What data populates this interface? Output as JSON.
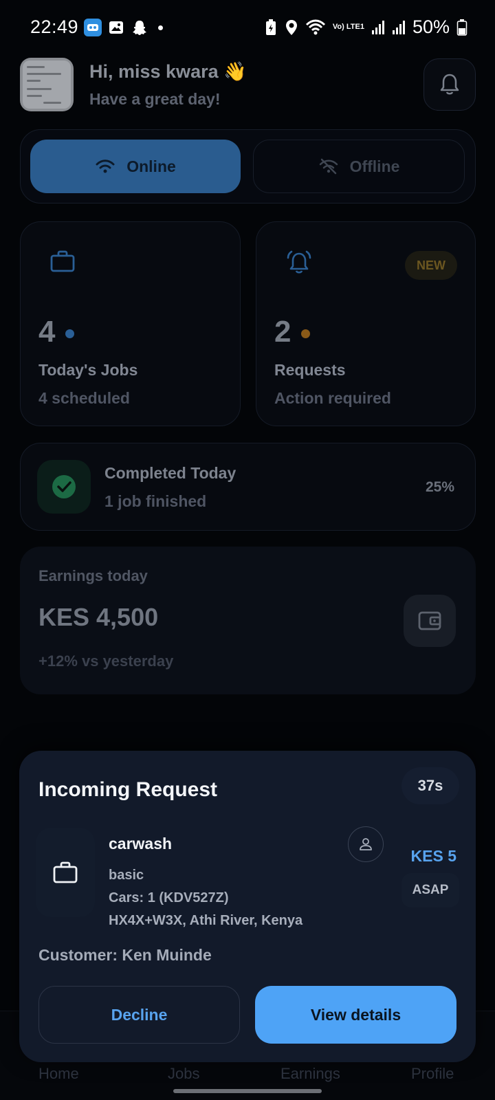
{
  "status_bar": {
    "time": "22:49",
    "battery": "50%",
    "network": "Vo) LTE1"
  },
  "header": {
    "greeting": "Hi, miss kwara 👋",
    "subtitle": "Have a great day!"
  },
  "availability": {
    "online_label": "Online",
    "offline_label": "Offline",
    "selected": "Online"
  },
  "stats": {
    "jobs": {
      "count": "4",
      "title": "Today's Jobs",
      "subtitle": "4 scheduled"
    },
    "requests": {
      "count": "2",
      "title": "Requests",
      "subtitle": "Action required",
      "badge": "NEW"
    }
  },
  "completed": {
    "title": "Completed Today",
    "subtitle": "1 job finished",
    "percent": "25%"
  },
  "earnings": {
    "label": "Earnings today",
    "amount": "KES 4,500",
    "change": "+12% vs yesterday"
  },
  "incoming_request": {
    "title": "Incoming Request",
    "timer": "37s",
    "service": "carwash",
    "tier": "basic",
    "cars": "Cars: 1 (KDV527Z)",
    "location": "HX4X+W3X, Athi River, Kenya",
    "price": "KES 5",
    "timing": "ASAP",
    "customer": "Customer: Ken Muinde",
    "decline_label": "Decline",
    "view_label": "View details"
  },
  "bottom_nav": {
    "items": [
      {
        "label": "Home"
      },
      {
        "label": "Jobs"
      },
      {
        "label": "Earnings"
      },
      {
        "label": "Profile"
      }
    ]
  },
  "colors": {
    "accent_blue": "#4ea3f6",
    "online_bg": "#2a5c8f",
    "success_green": "#1f7a4c",
    "warning_amber": "#b0741c"
  }
}
